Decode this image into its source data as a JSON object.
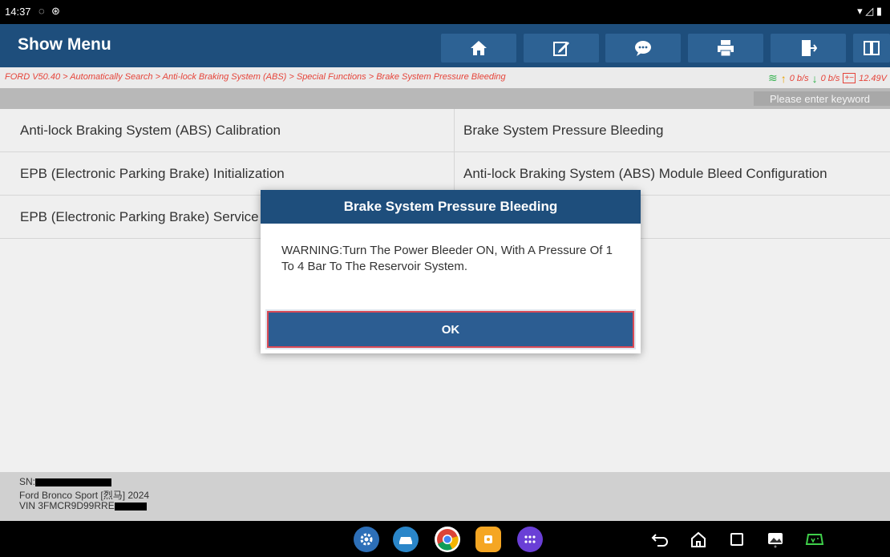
{
  "statusbar": {
    "time": "14:37",
    "icons": [
      "chat-bubble-icon",
      "bluetooth-icon",
      "wifi-icon",
      "signal-icon",
      "battery-icon"
    ]
  },
  "appbar": {
    "title": "Show Menu",
    "buttons": [
      "home-icon",
      "edit-icon",
      "message-icon",
      "print-icon",
      "exit-icon",
      "split-view-icon"
    ]
  },
  "breadcrumb": {
    "path": "FORD V50.40 > Automatically Search > Anti-lock Braking System (ABS) > Special Functions > Brake System Pressure Bleeding",
    "upload": "0 b/s",
    "download": "0 b/s",
    "voltage": "12.49V"
  },
  "search": {
    "placeholder": "Please enter keyword"
  },
  "menu": {
    "rows": [
      {
        "left": "Anti-lock Braking System (ABS) Calibration",
        "right": "Brake System Pressure Bleeding"
      },
      {
        "left": "EPB (Electronic Parking Brake) Initialization",
        "right": "Anti-lock Braking System (ABS) Module Bleed Configuration"
      },
      {
        "left": "EPB (Electronic Parking Brake) Service",
        "right": ""
      }
    ]
  },
  "footer": {
    "sn_label": "SN:",
    "vehicle": "Ford Bronco Sport [烈马] 2024",
    "vin_label": "VIN 3FMCR9D99RRE"
  },
  "dialog": {
    "title": "Brake System Pressure Bleeding",
    "message": "WARNING:Turn The Power Bleeder ON, With A Pressure Of 1 To 4 Bar To The Reservoir System.",
    "ok_label": "OK"
  },
  "colors": {
    "header": "#1e4e7c",
    "button": "#2d6294",
    "accent_red": "#e6443a"
  }
}
